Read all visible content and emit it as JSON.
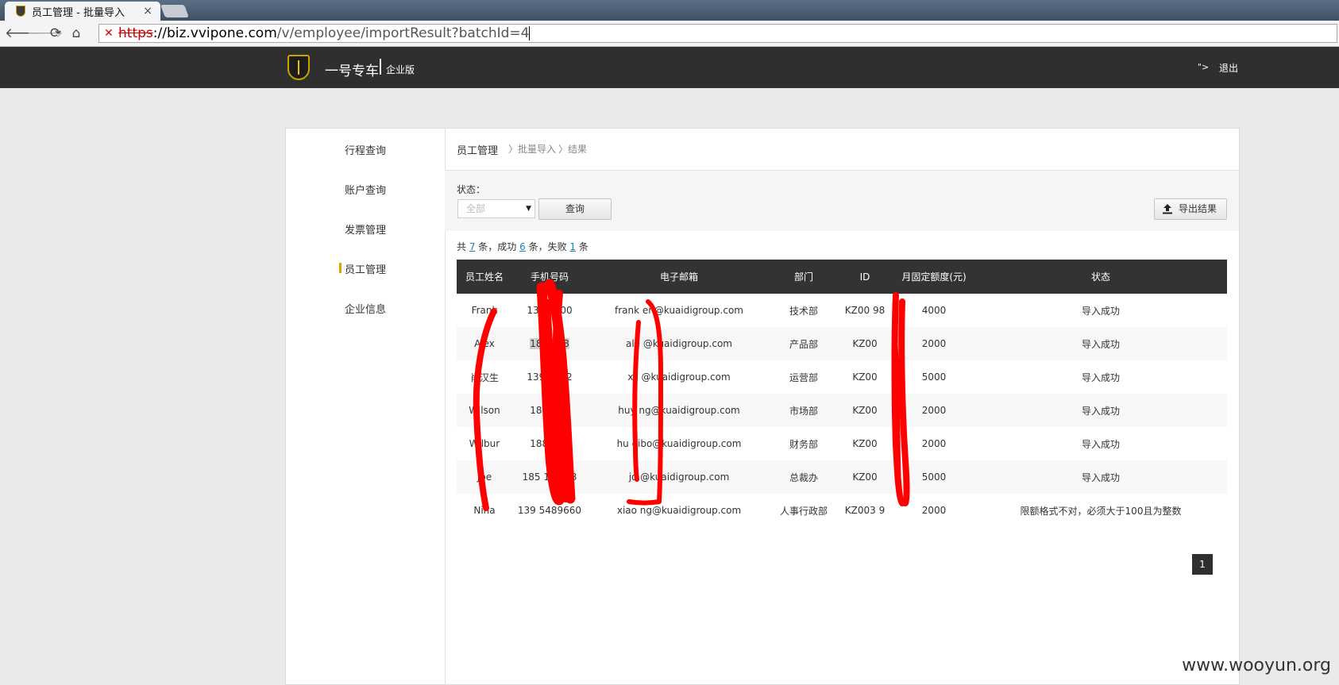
{
  "browser": {
    "tab_title": "员工管理 - 批量导入",
    "url_scheme": "https",
    "url_host": "://biz.vvipone.com",
    "url_path": "/v/employee/importResult?batchId=4"
  },
  "header": {
    "brand": "一号专车",
    "brand_sub": "企业版",
    "arrow": "\">",
    "logout": "退出"
  },
  "sidebar": {
    "items": [
      {
        "label": "行程查询"
      },
      {
        "label": "账户查询"
      },
      {
        "label": "发票管理"
      },
      {
        "label": "员工管理",
        "active": true
      },
      {
        "label": "企业信息"
      }
    ]
  },
  "breadcrumb": {
    "level1": "员工管理",
    "level2": "〉批量导入",
    "level3": "〉结果"
  },
  "filter": {
    "status_label": "状态：",
    "status_selected": "全部",
    "query_button": "查询",
    "export_button": "导出结果"
  },
  "summary": {
    "prefix": "共 ",
    "total": "7",
    "mid1": " 条，成功 ",
    "success": "6",
    "mid2": " 条，失败 ",
    "fail": "1",
    "suffix": " 条"
  },
  "table": {
    "headers": [
      "员工姓名",
      "手机号码",
      "电子邮箱",
      "部门",
      "ID",
      "月固定额度(元)",
      "状态"
    ],
    "rows": [
      [
        "Frank",
        "133 1200",
        "frank en@kuaidigroup.com",
        "技术部",
        "KZ00 98",
        "4000",
        "导入成功"
      ],
      [
        "Alex",
        "186 398",
        "ale @kuaidigroup.com",
        "产品部",
        "KZ00",
        "2000",
        "导入成功"
      ],
      [
        "肖汉生",
        "1390 902",
        "xs @kuaidigroup.com",
        "运营部",
        "KZ00",
        "5000",
        "导入成功"
      ],
      [
        "Wilson",
        "186 472",
        "huy ng@kuaidigroup.com",
        "市场部",
        "KZ00",
        "2000",
        "导入成功"
      ],
      [
        "Wilbur",
        "188 006",
        "hu eibo@kuaidigroup.com",
        "财务部",
        "KZ00",
        "2000",
        "导入成功"
      ],
      [
        "Joe",
        "185 14 388",
        "jo @kuaidigroup.com",
        "总裁办",
        "KZ00",
        "5000",
        "导入成功"
      ],
      [
        "Nina",
        "139 5489660",
        "xiao ng@kuaidigroup.com",
        "人事行政部",
        "KZ003 9",
        "2000",
        "限额格式不对，必须大于100且为整数"
      ]
    ]
  },
  "pagination": {
    "current": "1"
  },
  "watermark": "www.wooyun.org"
}
